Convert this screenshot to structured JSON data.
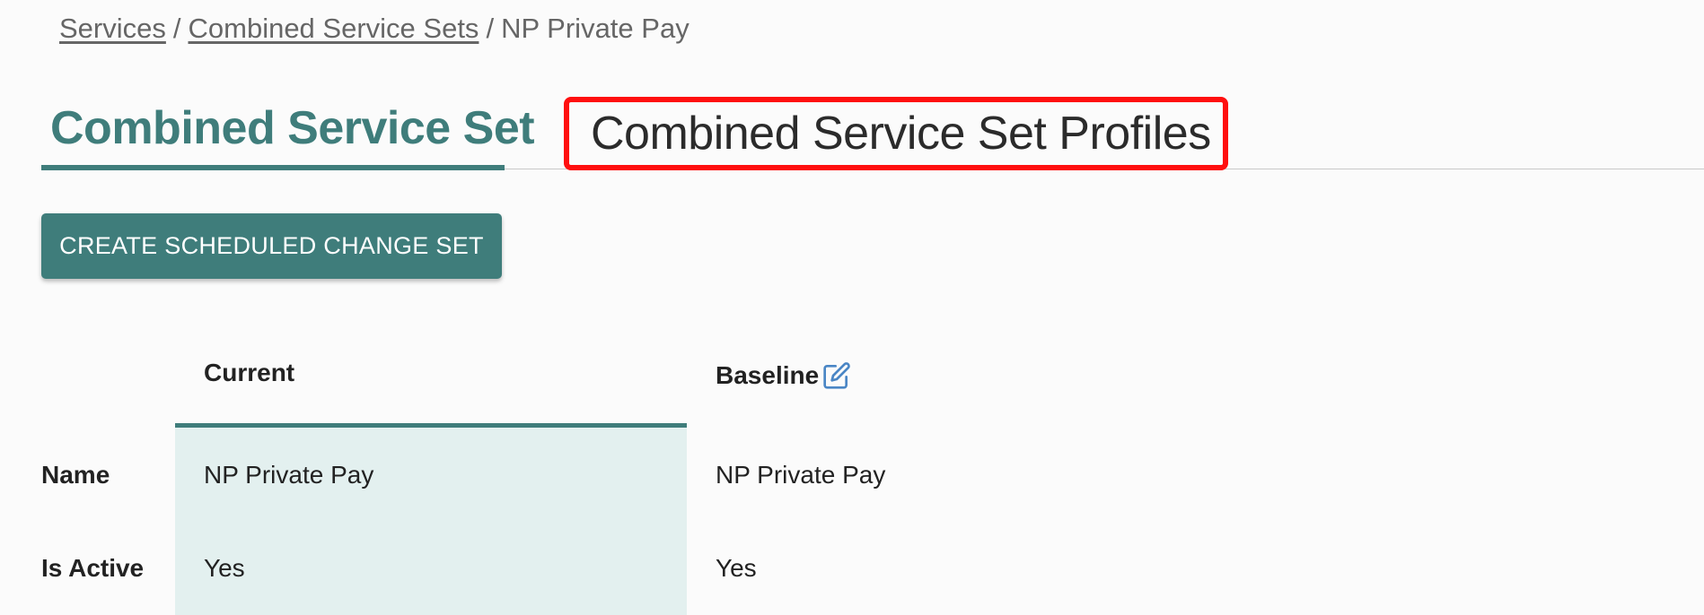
{
  "breadcrumb": {
    "items": [
      "Services",
      "Combined Service Sets",
      "NP Private Pay"
    ],
    "separator": "/"
  },
  "tabs": [
    {
      "label": "Combined Service Set",
      "active": true
    },
    {
      "label": "Combined Service Set Profiles",
      "active": false
    }
  ],
  "actions": {
    "create_label": "CREATE SCHEDULED CHANGE SET"
  },
  "comparison": {
    "columns": {
      "current": "Current",
      "baseline": "Baseline"
    },
    "baseline_icon": "edit-icon",
    "rows": [
      {
        "label": "Name",
        "current": "NP Private Pay",
        "baseline": "NP Private Pay"
      },
      {
        "label": "Is Active",
        "current": "Yes",
        "baseline": "Yes"
      }
    ]
  },
  "colors": {
    "accent": "#3f7d7b",
    "current_bg": "#e3f0ef",
    "highlight_box": "#ff0f0f",
    "icon": "#4a86c5"
  }
}
